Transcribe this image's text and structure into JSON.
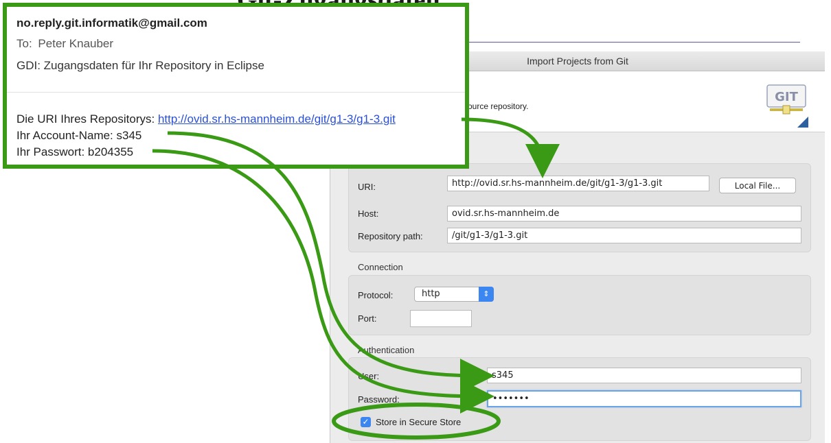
{
  "background": {
    "heading": "Git-Zugangsdaten"
  },
  "dialog": {
    "title": "Import Projects from Git",
    "description": "ource repository.",
    "logo_text": "GIT",
    "uri_label": "URI:",
    "uri_value": "http://ovid.sr.hs-mannheim.de/git/g1-3/g1-3.git",
    "local_file_button": "Local File...",
    "host_label": "Host:",
    "host_value": "ovid.sr.hs-mannheim.de",
    "repo_path_label": "Repository path:",
    "repo_path_value": "/git/g1-3/g1-3.git",
    "connection_section": "Connection",
    "protocol_label": "Protocol:",
    "protocol_value": "http",
    "port_label": "Port:",
    "port_value": "",
    "authentication_section": "Authentication",
    "user_label": "User:",
    "user_value": "s345",
    "password_label": "Password:",
    "password_value": "•••••••",
    "store_label": "Store in Secure Store",
    "store_checked": true
  },
  "email": {
    "from": "no.reply.git.informatik@gmail.com",
    "to_label": "To:",
    "to_name": "Peter Knauber",
    "subject": "GDI: Zugangsdaten für Ihr Repository in Eclipse",
    "uri_prefix": "Die URI Ihres Repositorys:",
    "uri_link": "http://ovid.sr.hs-mannheim.de/git/g1-3/g1-3.git",
    "account_line": "Ihr Account-Name: s345",
    "password_line": "Ihr Passwort: b204355"
  },
  "colors": {
    "highlight_green": "#3a9a15",
    "link_blue": "#2a50d8",
    "accent_blue": "#3b86f0"
  }
}
